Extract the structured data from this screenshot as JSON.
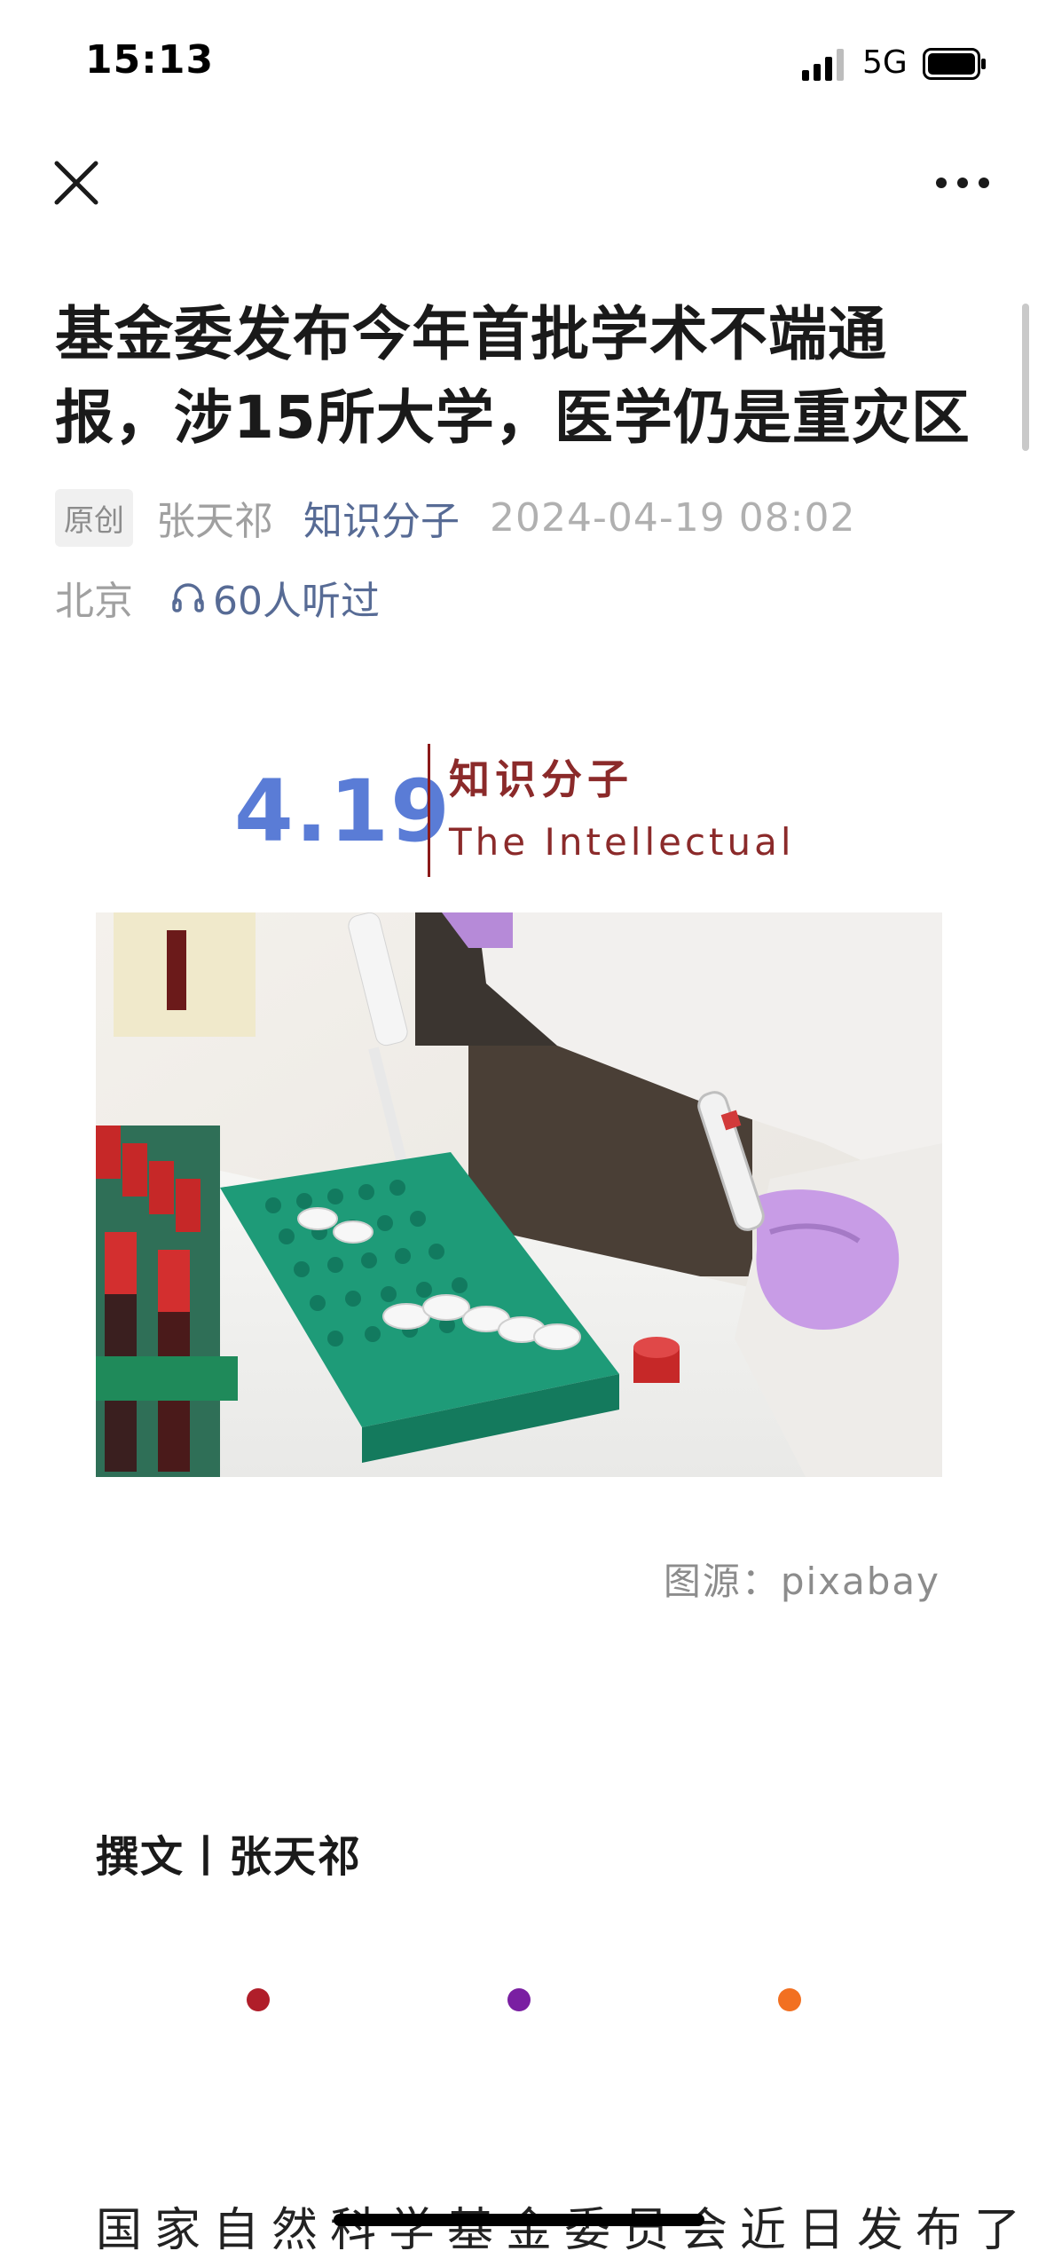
{
  "status_bar": {
    "time": "15:13",
    "network": "5G",
    "icons": [
      "signal-icon",
      "battery-icon"
    ]
  },
  "nav": {
    "close_icon": "close-icon",
    "more_icon": "more-icon"
  },
  "article": {
    "title": "基金委发布今年首批学术不端通报，涉15所大学，医学仍是重灾区",
    "badge": "原创",
    "author": "张天祁",
    "account": "知识分子",
    "datetime": "2024-04-19 08:02",
    "location": "北京",
    "listened": "60人听过",
    "header": {
      "date": "4.19",
      "brand_cn": "知识分子",
      "brand_en": "The Intellectual"
    },
    "image_caption": "图源：pixabay",
    "byline": "撰文丨张天祁",
    "body_first_line": "国家自然科学基金委员会近日发布了"
  },
  "colors": {
    "accent_blue": "#5a7cd6",
    "brand_red": "#8b2a2a",
    "link_blue": "#576b95",
    "dot1": "#b01e2a",
    "dot2": "#7a1fa2",
    "dot3": "#f27021"
  }
}
